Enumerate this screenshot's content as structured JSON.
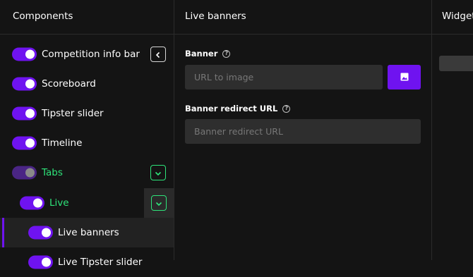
{
  "components": {
    "title": "Components",
    "items": [
      {
        "label": "Competition info bar"
      },
      {
        "label": "Scoreboard"
      },
      {
        "label": "Tipster slider"
      },
      {
        "label": "Timeline"
      },
      {
        "label": "Tabs"
      },
      {
        "label": "Live"
      },
      {
        "label": "Live banners"
      },
      {
        "label": "Live Tipster slider"
      }
    ]
  },
  "settings": {
    "title": "Live banners",
    "banner": {
      "label": "Banner",
      "placeholder": "URL to image",
      "value": ""
    },
    "redirect": {
      "label": "Banner redirect URL",
      "placeholder": "Banner redirect URL",
      "value": ""
    }
  },
  "widgets": {
    "title": "Widget"
  },
  "colors": {
    "accent": "#6f13f0",
    "active_text": "#2ee47a",
    "background": "#141414"
  },
  "icons": {
    "collapse": "chevron-left-icon",
    "expand": "chevron-down-icon",
    "image": "image-icon",
    "help": "help-icon"
  }
}
